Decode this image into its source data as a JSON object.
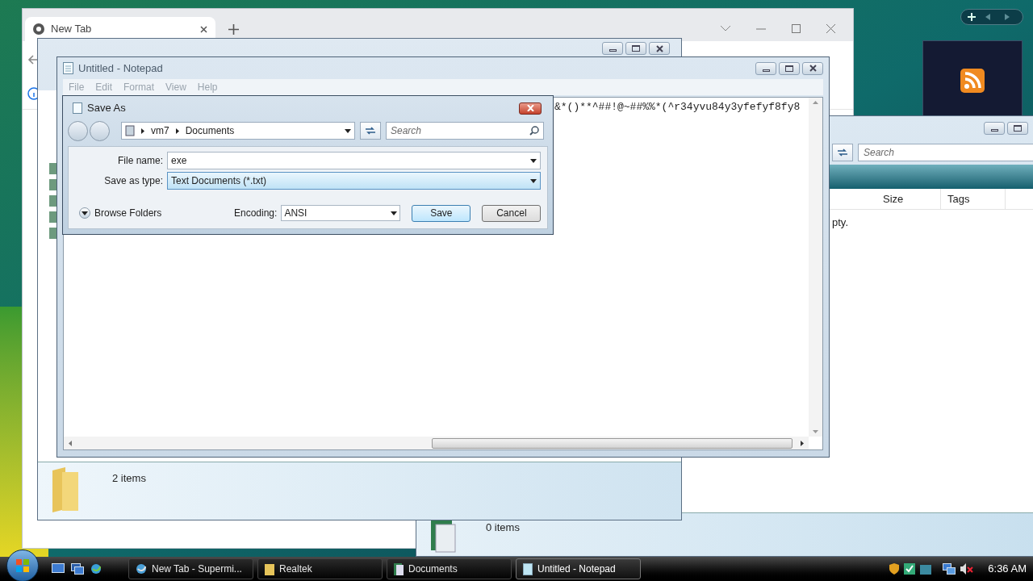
{
  "documents_window": {
    "search_placeholder": "Search",
    "columns": [
      "Size",
      "Tags"
    ],
    "content_text": "pty.",
    "status": "0 items"
  },
  "browser_window": {
    "tab_title": "New Tab"
  },
  "realtek_window": {
    "status": "2 items"
  },
  "notepad": {
    "title": "Untitled - Notepad",
    "menu": [
      {
        "label": "File",
        "disabled": true
      },
      {
        "label": "Edit",
        "disabled": true
      },
      {
        "label": "Format",
        "disabled": true
      },
      {
        "label": "View",
        "disabled": true
      },
      {
        "label": "Help",
        "disabled": true
      }
    ],
    "text": "&*()**^##!@~##%%*(^r34yvu84y3yfefyf8fy8"
  },
  "save_as": {
    "title": "Save As",
    "breadcrumb": [
      "vm7",
      "Documents"
    ],
    "search_placeholder": "Search",
    "fields": [
      {
        "label": "File name:",
        "value": "exe",
        "highlighted": false
      },
      {
        "label": "Save as type:",
        "value": "Text Documents (*.txt)",
        "highlighted": true
      }
    ],
    "browse_folders": "Browse Folders",
    "encoding_label": "Encoding:",
    "encoding": "ANSI",
    "buttons": [
      {
        "label": "Save",
        "default": true
      },
      {
        "label": "Cancel",
        "default": false
      }
    ]
  },
  "taskbar": {
    "buttons": [
      {
        "label": "New Tab - Supermi...",
        "kind": "browser",
        "selected": false
      },
      {
        "label": "Realtek",
        "kind": "folder",
        "selected": false
      },
      {
        "label": "Documents",
        "kind": "documents",
        "selected": false
      },
      {
        "label": "Untitled - Notepad",
        "kind": "notepad",
        "selected": true
      }
    ],
    "clock": "6:36 AM"
  }
}
